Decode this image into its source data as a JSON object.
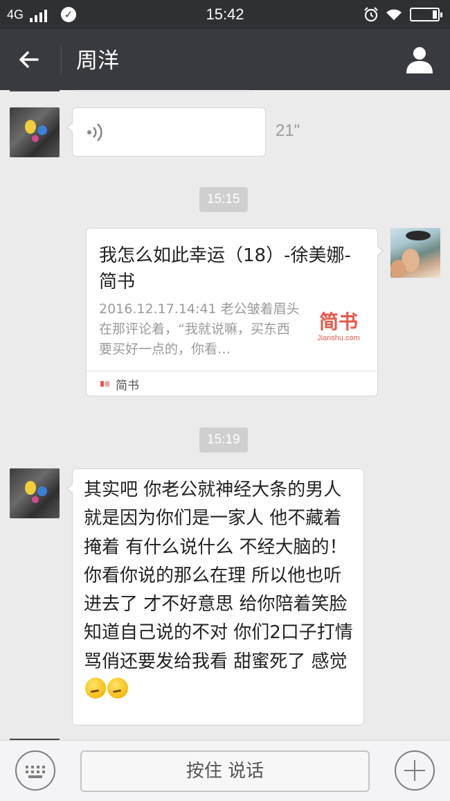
{
  "status_bar": {
    "network": "4G",
    "time": "15:42",
    "icons": [
      "signal-icon",
      "check-icon",
      "alarm-icon",
      "wifi-icon",
      "battery-icon"
    ],
    "battery_level": 0.15
  },
  "nav": {
    "title": "周洋",
    "back_icon": "arrow-left-icon",
    "profile_icon": "person-icon"
  },
  "messages": [
    {
      "type": "voice",
      "side": "left",
      "duration": "21\""
    },
    {
      "type": "timestamp",
      "text": "15:15"
    },
    {
      "type": "link",
      "side": "right",
      "title": "我怎么如此幸运（18）-徐美娜-简书",
      "description": "2016.12.17.14:41 老公皱着眉头在那评论着，“我就说嘛，买东西要买好一点的，你看…",
      "logo_text": "简书",
      "logo_sub": "Jianshu.com",
      "source": "简书"
    },
    {
      "type": "timestamp",
      "text": "15:19"
    },
    {
      "type": "text",
      "side": "left",
      "text": "其实吧 你老公就神经大条的男人 就是因为你们是一家人 他不藏着掩着 有什么说什么 不经大脑的！你看你说的那么在理 所以他也听进去了 才不好意思 给你陪着笑脸 知道自己说的不对 你们2口子打情骂俏还要发给我看 甜蜜死了 感觉",
      "emoji": [
        "thinking-face-emoji",
        "thinking-face-emoji"
      ]
    }
  ],
  "input_bar": {
    "talk_label": "按住 说话",
    "keyboard_icon": "keyboard-icon",
    "add_icon": "plus-icon"
  },
  "colors": {
    "status_bar_bg": "#2e3033",
    "nav_bg": "#393a3f",
    "chat_bg": "#ebebeb",
    "bubble_bg": "#ffffff",
    "timestamp_bg": "#cfcfcf",
    "jianshu_red": "#e8584a"
  }
}
